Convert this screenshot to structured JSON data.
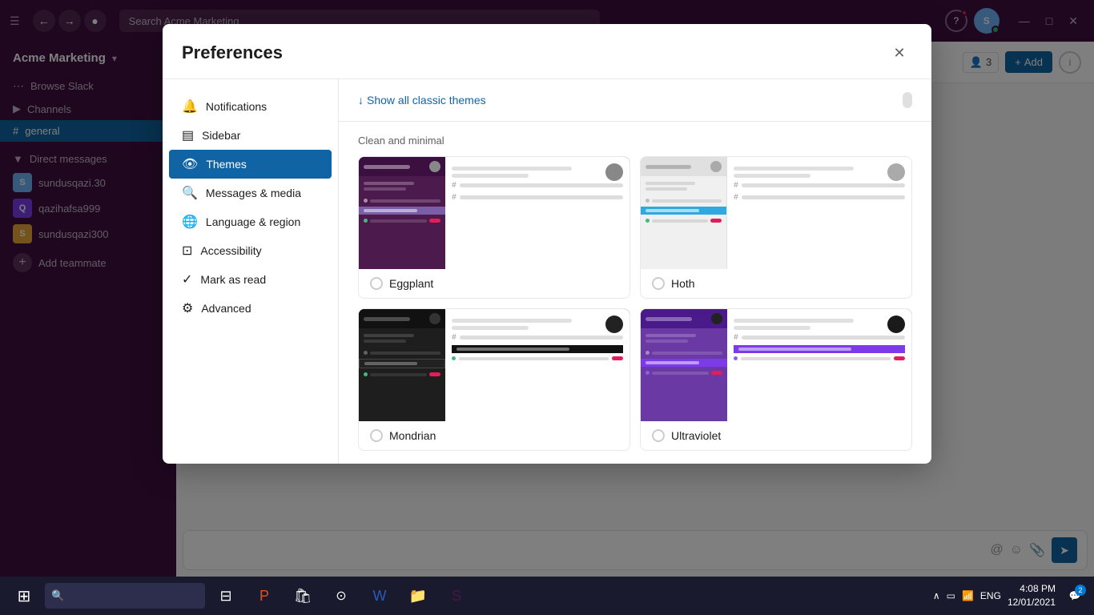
{
  "app": {
    "title": "Acme Marketing",
    "workspace": "Acme Marketing",
    "search_placeholder": "Search Acme Marketing"
  },
  "titlebar": {
    "back": "←",
    "forward": "→",
    "history": "🕐",
    "minimize": "—",
    "maximize": "□",
    "close": "✕"
  },
  "sidebar": {
    "browse_label": "Browse Slack",
    "channels_label": "Channels",
    "channels_icon": "▶",
    "active_channel": "general",
    "dm_header": "Direct messages",
    "dm_icon": "▼",
    "users": [
      {
        "name": "sundusqazi.30",
        "initials": "S"
      },
      {
        "name": "qazihafsa999",
        "initials": "Q"
      },
      {
        "name": "sundusqazi300",
        "initials": "S"
      }
    ],
    "add_teammate": "Add teammate"
  },
  "preferences": {
    "title": "Preferences",
    "close_label": "✕",
    "menu_items": [
      {
        "id": "notifications",
        "label": "Notifications",
        "icon": "🔔"
      },
      {
        "id": "sidebar",
        "label": "Sidebar",
        "icon": "▤"
      },
      {
        "id": "themes",
        "label": "Themes",
        "icon": "👁"
      },
      {
        "id": "messages",
        "label": "Messages & media",
        "icon": "🔍"
      },
      {
        "id": "language",
        "label": "Language & region",
        "icon": "🌐"
      },
      {
        "id": "accessibility",
        "label": "Accessibility",
        "icon": "⊡"
      },
      {
        "id": "mark_as_read",
        "label": "Mark as read",
        "icon": "✓"
      },
      {
        "id": "advanced",
        "label": "Advanced",
        "icon": "⚙"
      }
    ],
    "active_menu": "themes",
    "show_classic_themes": "Show all classic themes",
    "section_label": "Clean and minimal",
    "themes": [
      {
        "id": "eggplant",
        "name": "Eggplant",
        "selected": false,
        "sidebar_color": "#4d1a4d",
        "header_color": "#3b1040",
        "active_color": "#7b5ea7",
        "avatar_color": "#888888"
      },
      {
        "id": "hoth",
        "name": "Hoth",
        "selected": false,
        "sidebar_color": "#f0f0f0",
        "header_color": "#e8e8e8",
        "active_color": "#2fa9e0",
        "avatar_color": "#aaaaaa"
      },
      {
        "id": "mondrian",
        "name": "Mondrian",
        "selected": false,
        "sidebar_color": "#1e1e1e",
        "header_color": "#111111",
        "active_color": "#2b2b2b",
        "avatar_color": "#333333"
      },
      {
        "id": "ultraviolet",
        "name": "Ultraviolet",
        "selected": false,
        "sidebar_color": "#6b39a3",
        "header_color": "#4a1a8a",
        "active_color": "#7c3ae8",
        "avatar_color": "#222222"
      }
    ]
  },
  "taskbar": {
    "time": "4:08 PM",
    "date": "12/01/2021",
    "language": "ENG",
    "notification_count": "2"
  }
}
